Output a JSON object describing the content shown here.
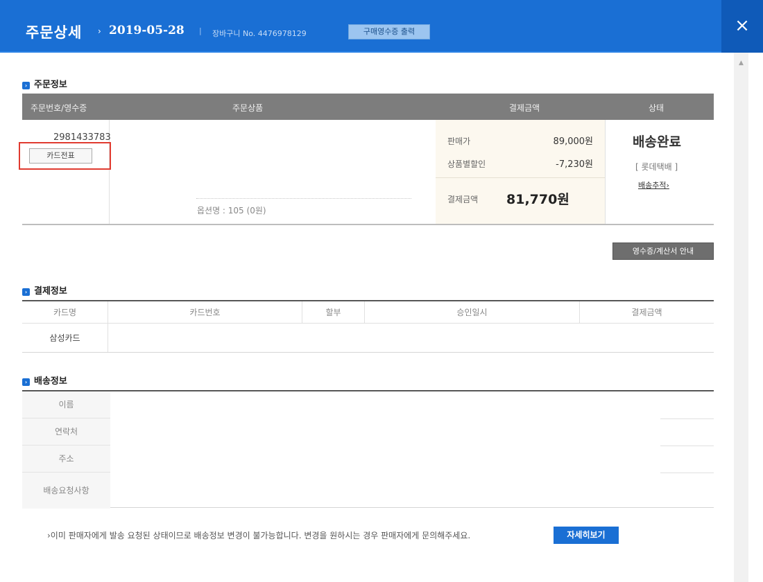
{
  "header": {
    "title": "주문상세",
    "arrow": "›",
    "date": "2019-05-28",
    "separator": "|",
    "basket_label": "장바구니 No. 4476978129",
    "print_button": "구매영수증 출력",
    "close_icon": "×"
  },
  "sections": {
    "order_title": "주문정보",
    "payment_title": "결제정보",
    "shipping_title": "배송정보",
    "bullet": "›"
  },
  "order_table": {
    "headers": [
      "주문번호/영수증",
      "주문상품",
      "결제금액",
      "상태"
    ],
    "order_number": "2981433783",
    "card_slip_button": "카드전표",
    "option_name": "옵션명 : 105 (0원)",
    "price_label": "판매가",
    "price_value": "89,000원",
    "discount_label": "상품별할인",
    "discount_value": "-7,230원",
    "total_label": "결제금액",
    "total_value": "81,770원",
    "status": "배송완료",
    "carrier": "[ 롯데택배 ]",
    "tracking_link": "배송추적›"
  },
  "receipt_button": "영수증/계산서 안내",
  "payment_table": {
    "headers": [
      "카드명",
      "카드번호",
      "할부",
      "승인일시",
      "결제금액"
    ],
    "row": [
      "삼성카드",
      "",
      "",
      "",
      ""
    ]
  },
  "shipping_table": {
    "labels": [
      "이름",
      "연락처",
      "주소",
      "배송요청사항"
    ]
  },
  "notice": "›이미 판매자에게 발송 요청된 상태이므로 배송정보 변경이 불가능합니다. 변경을 원하시는 경우 판매자에게 문의해주세요.",
  "detail_button": "자세히보기",
  "colors": {
    "header_blue": "#1a6fd4",
    "close_blue": "#0f5ab8",
    "table_head_gray": "#7d7d7d",
    "pay_box_bg": "#fcf8ef",
    "highlight_red": "#e03a2f"
  },
  "scroll_up_icon": "▲"
}
